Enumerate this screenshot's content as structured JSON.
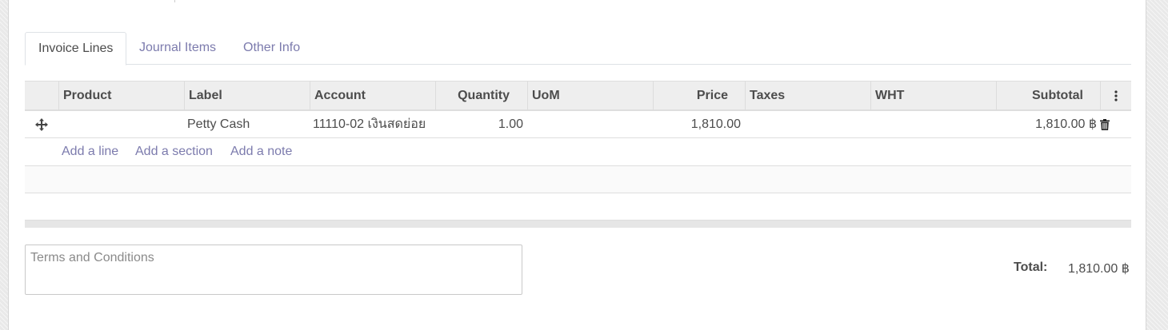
{
  "tabs": [
    {
      "label": "Invoice Lines",
      "active": true
    },
    {
      "label": "Journal Items",
      "active": false
    },
    {
      "label": "Other Info",
      "active": false
    }
  ],
  "table": {
    "columns": {
      "product": "Product",
      "label": "Label",
      "account": "Account",
      "quantity": "Quantity",
      "uom": "UoM",
      "price": "Price",
      "taxes": "Taxes",
      "wht": "WHT",
      "subtotal": "Subtotal"
    },
    "rows": [
      {
        "product": "",
        "label": "Petty Cash",
        "account": "11110-02 เงินสดย่อย",
        "quantity": "1.00",
        "uom": "",
        "price": "1,810.00",
        "taxes": "",
        "wht": "",
        "subtotal": "1,810.00 ฿"
      }
    ],
    "add_links": {
      "line": "Add a line",
      "section": "Add a section",
      "note": "Add a note"
    }
  },
  "terms": {
    "placeholder": "Terms and Conditions"
  },
  "totals": {
    "label": "Total:",
    "value": "1,810.00 ฿"
  },
  "icons": {
    "drag_handle": "move-arrows-icon",
    "delete": "trash-icon",
    "column_options": "vertical-ellipsis-icon"
  },
  "colors": {
    "link": "#7c7bad",
    "text": "#4c4c4c",
    "header_bg": "#eeeeee"
  }
}
